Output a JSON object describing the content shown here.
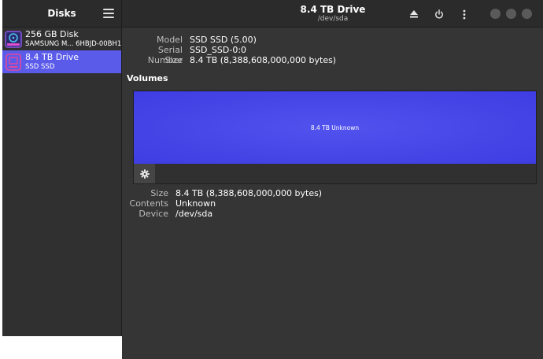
{
  "sidebar": {
    "title": "Disks",
    "menu_icon": "hamburger-menu-icon",
    "items": [
      {
        "name": "256 GB Disk",
        "sub": "SAMSUNG M... 6HBJD-00BH1",
        "icon": "hard-disk-icon",
        "selected": false
      },
      {
        "name": "8.4 TB Drive",
        "sub": "SSD SSD",
        "icon": "drive-icon",
        "selected": true
      }
    ]
  },
  "header": {
    "title": "8.4 TB Drive",
    "subtitle": "/dev/sda",
    "eject_icon": "eject-icon",
    "power_icon": "power-icon",
    "more_icon": "kebab-menu-icon"
  },
  "drive_info": {
    "model_label": "Model",
    "model_value": "SSD SSD (5.00)",
    "serial_label": "Serial Number",
    "serial_value": "SSD_SSD-0:0",
    "size_label": "Size",
    "size_value": "8.4 TB (8,388,608,000,000 bytes)"
  },
  "volumes": {
    "title": "Volumes",
    "bar_label": "8.4 TB Unknown",
    "gear_icon": "gear-icon"
  },
  "partition_info": {
    "size_label": "Size",
    "size_value": "8.4 TB (8,388,608,000,000 bytes)",
    "contents_label": "Contents",
    "contents_value": "Unknown",
    "device_label": "Device",
    "device_value": "/dev/sda"
  },
  "colors": {
    "accent": "#5b5bea",
    "volume_bar": "#4444e6",
    "background": "#353535",
    "sidebar": "#303030"
  }
}
